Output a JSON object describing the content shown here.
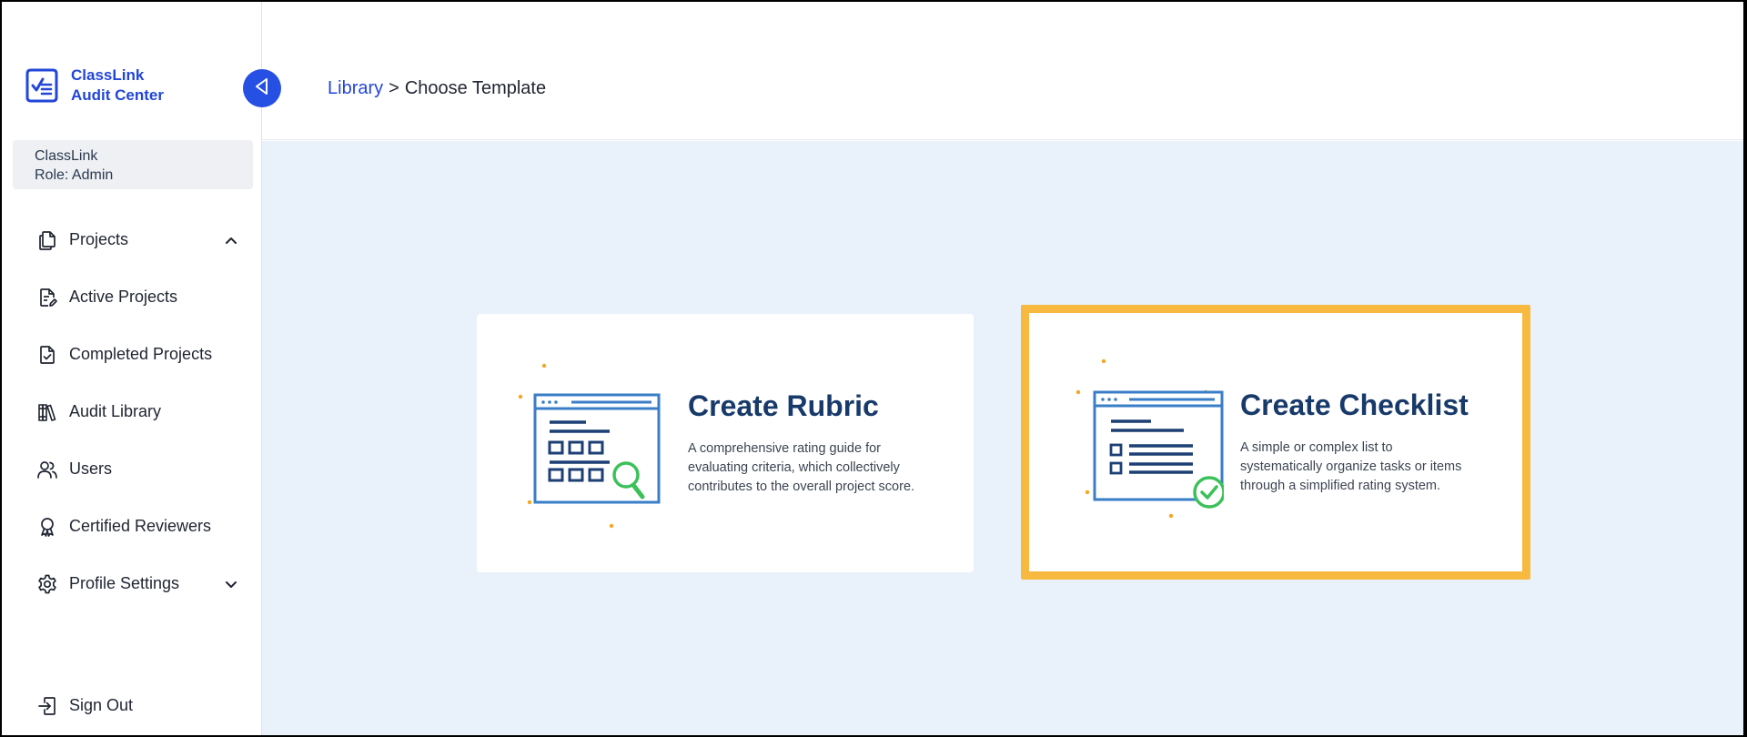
{
  "brand": {
    "line1": "ClassLink",
    "line2": "Audit Center"
  },
  "org": {
    "name": "ClassLink",
    "role": "Role: Admin"
  },
  "nav": {
    "projects": "Projects",
    "active_projects": "Active Projects",
    "completed_projects": "Completed Projects",
    "audit_library": "Audit Library",
    "users": "Users",
    "certified_reviewers": "Certified Reviewers",
    "profile_settings": "Profile Settings",
    "sign_out": "Sign Out"
  },
  "breadcrumb": {
    "link": "Library",
    "separator": ">",
    "current": "Choose Template"
  },
  "cards": [
    {
      "title": "Create Rubric",
      "description": "A comprehensive rating guide for evaluating criteria, which collectively contributes to the overall project score.",
      "icon": "rubric-illustration"
    },
    {
      "title": "Create Checklist",
      "description": "A simple or complex list to systematically organize tasks or items through a simplified rating system.",
      "icon": "checklist-illustration",
      "selected": true
    }
  ],
  "colors": {
    "brand_blue": "#2246d8",
    "title_navy": "#183a6a",
    "highlight": "#f7b940",
    "content_bg": "#e9f2fb",
    "accent_green": "#3cc15a",
    "dot_orange": "#f5a623"
  }
}
